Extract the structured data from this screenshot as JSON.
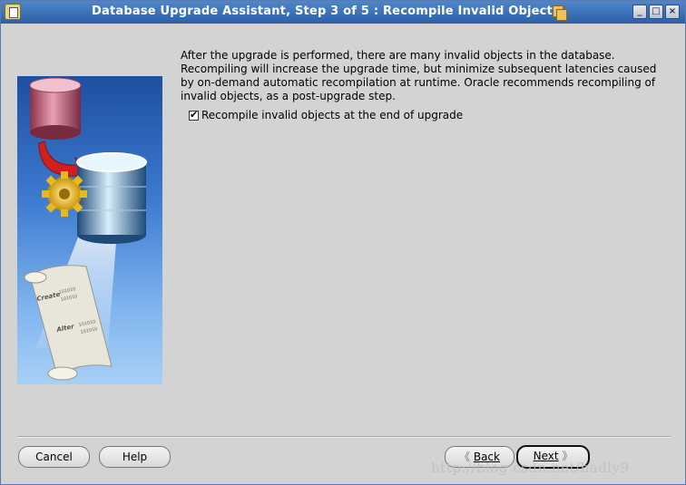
{
  "window": {
    "title": "Database Upgrade Assistant, Step 3 of 5 : Recompile Invalid Object",
    "controls": {
      "minimize": "_",
      "maximize": "□",
      "close": "×"
    }
  },
  "description": "After the upgrade is performed, there are many invalid objects in the database. Recompiling will increase the upgrade time, but minimize subsequent latencies caused by on-demand automatic recompilation at runtime. Oracle recommends recompiling of invalid objects, as a post-upgrade step.",
  "recompile_checkbox": {
    "label": "Recompile invalid objects at the end of upgrade",
    "checked": true
  },
  "illustration": {
    "scroll_words": [
      "Create",
      "Alter"
    ],
    "binary_lines": [
      "101010",
      "101010",
      "101010",
      "101010"
    ]
  },
  "buttons": {
    "cancel": "Cancel",
    "help": "Help",
    "back": "Back",
    "next": "Next",
    "back_arrow": "《",
    "next_arrow": "》"
  },
  "watermark": "http://blog.csdn.net/badly9"
}
